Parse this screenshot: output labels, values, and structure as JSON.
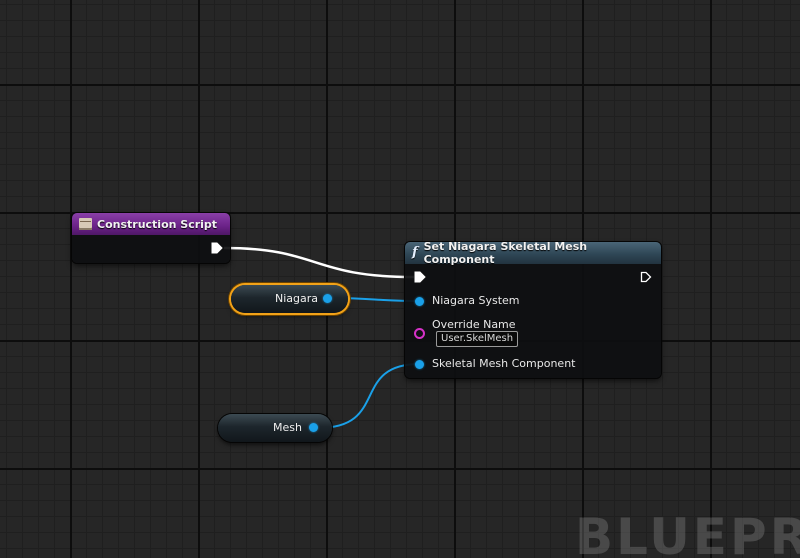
{
  "nodes": {
    "construction_script": {
      "title": "Construction Script",
      "header_color": "#6b2288",
      "icon": "event-icon"
    },
    "set_niagara": {
      "title": "Set Niagara Skeletal Mesh Component",
      "header_color": "#2f4756",
      "icon": "function-icon",
      "pins": {
        "niagara_system": "Niagara System",
        "override_name": "Override Name",
        "override_name_value": "User.SkelMesh",
        "skeletal_mesh_component": "Skeletal Mesh Component"
      }
    }
  },
  "variables": {
    "niagara": {
      "label": "Niagara",
      "selected": true
    },
    "mesh": {
      "label": "Mesh",
      "selected": false
    }
  },
  "colors": {
    "exec_wire": "#ffffff",
    "object_pin": "#1aa0e8",
    "name_pin": "#d632c8",
    "selection": "#f2a218"
  },
  "watermark": "BLUEPRIN"
}
